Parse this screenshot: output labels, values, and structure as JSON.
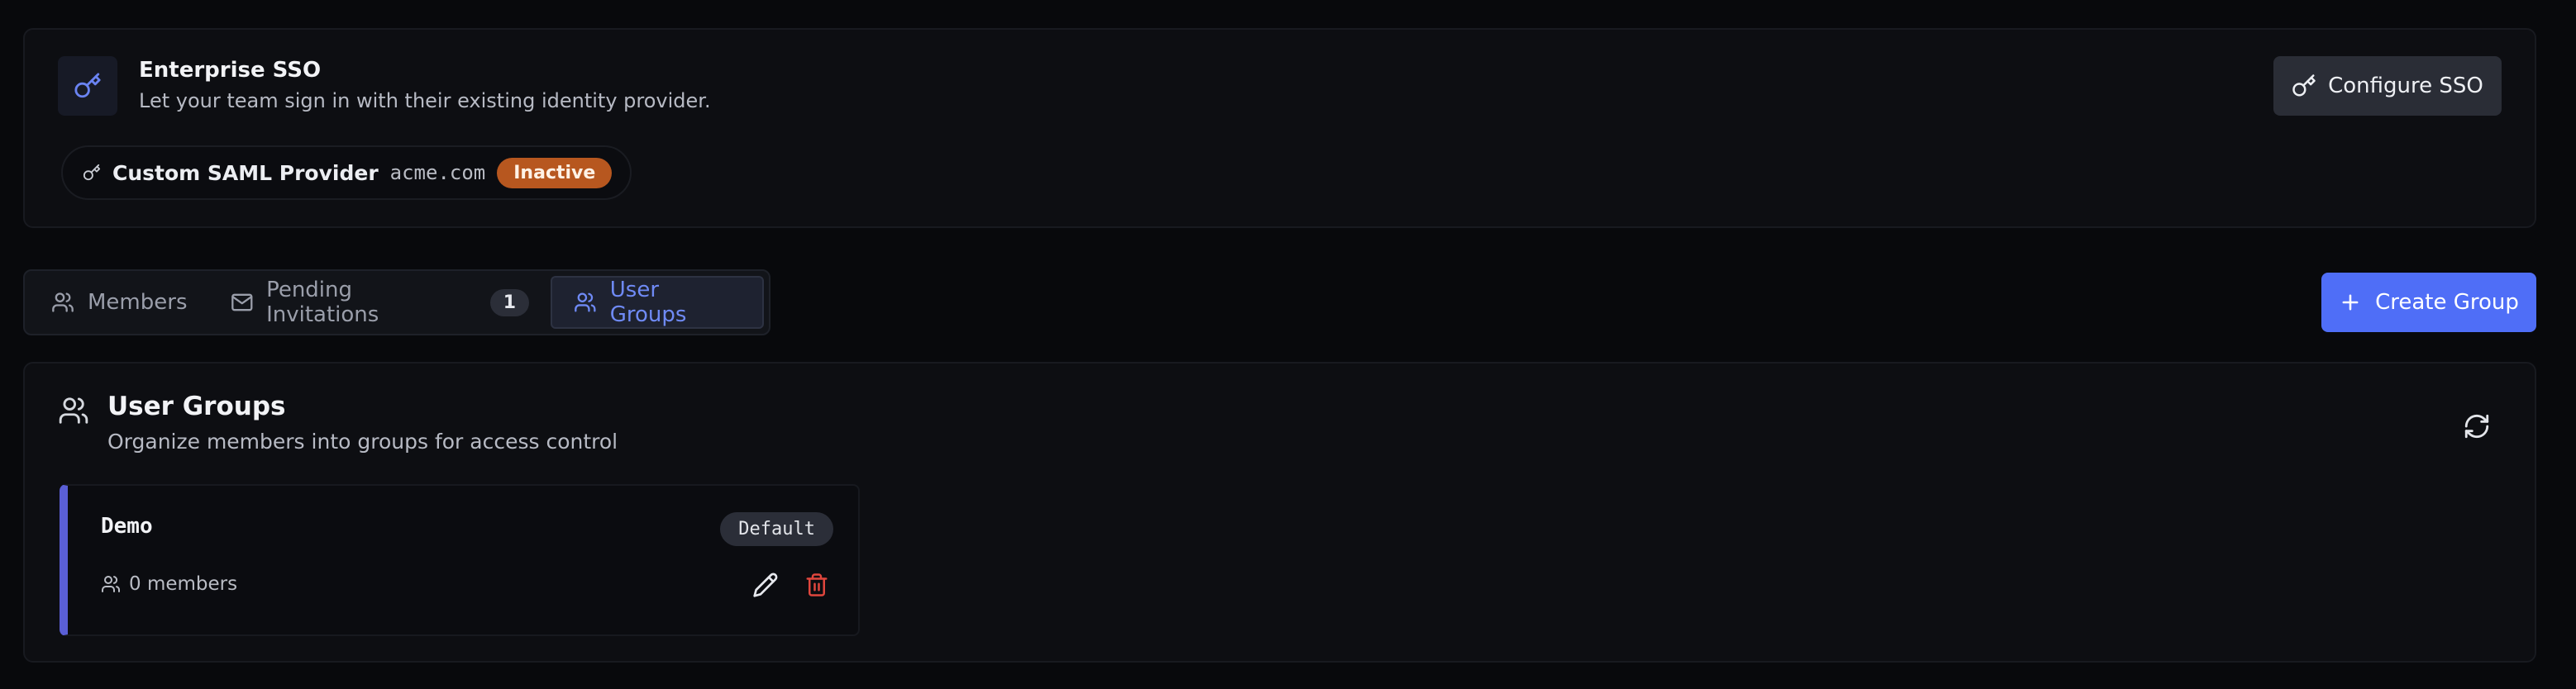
{
  "sso": {
    "title": "Enterprise SSO",
    "description": "Let your team sign in with their existing identity provider.",
    "provider_name": "Custom SAML Provider",
    "provider_domain": "acme.com",
    "provider_status": "Inactive",
    "configure_label": "Configure SSO",
    "icon": "key-icon"
  },
  "tabs": [
    {
      "label": "Members",
      "icon": "users-icon",
      "active": false
    },
    {
      "label": "Pending Invitations",
      "icon": "mail-icon",
      "badge": "1",
      "active": false
    },
    {
      "label": "User Groups",
      "icon": "users-icon",
      "active": true
    }
  ],
  "create_group_label": "Create Group",
  "groups_section": {
    "title": "User Groups",
    "description": "Organize members into groups for access control"
  },
  "groups": [
    {
      "name": "Demo",
      "badge": "Default",
      "members": "0 members"
    }
  ],
  "colors": {
    "accent": "#4f6ef7",
    "active_tab_text": "#6f8af5",
    "inactive_badge": "#b7571f",
    "delete": "#e0463d",
    "group_accent_bar": "#5a5fd6"
  }
}
